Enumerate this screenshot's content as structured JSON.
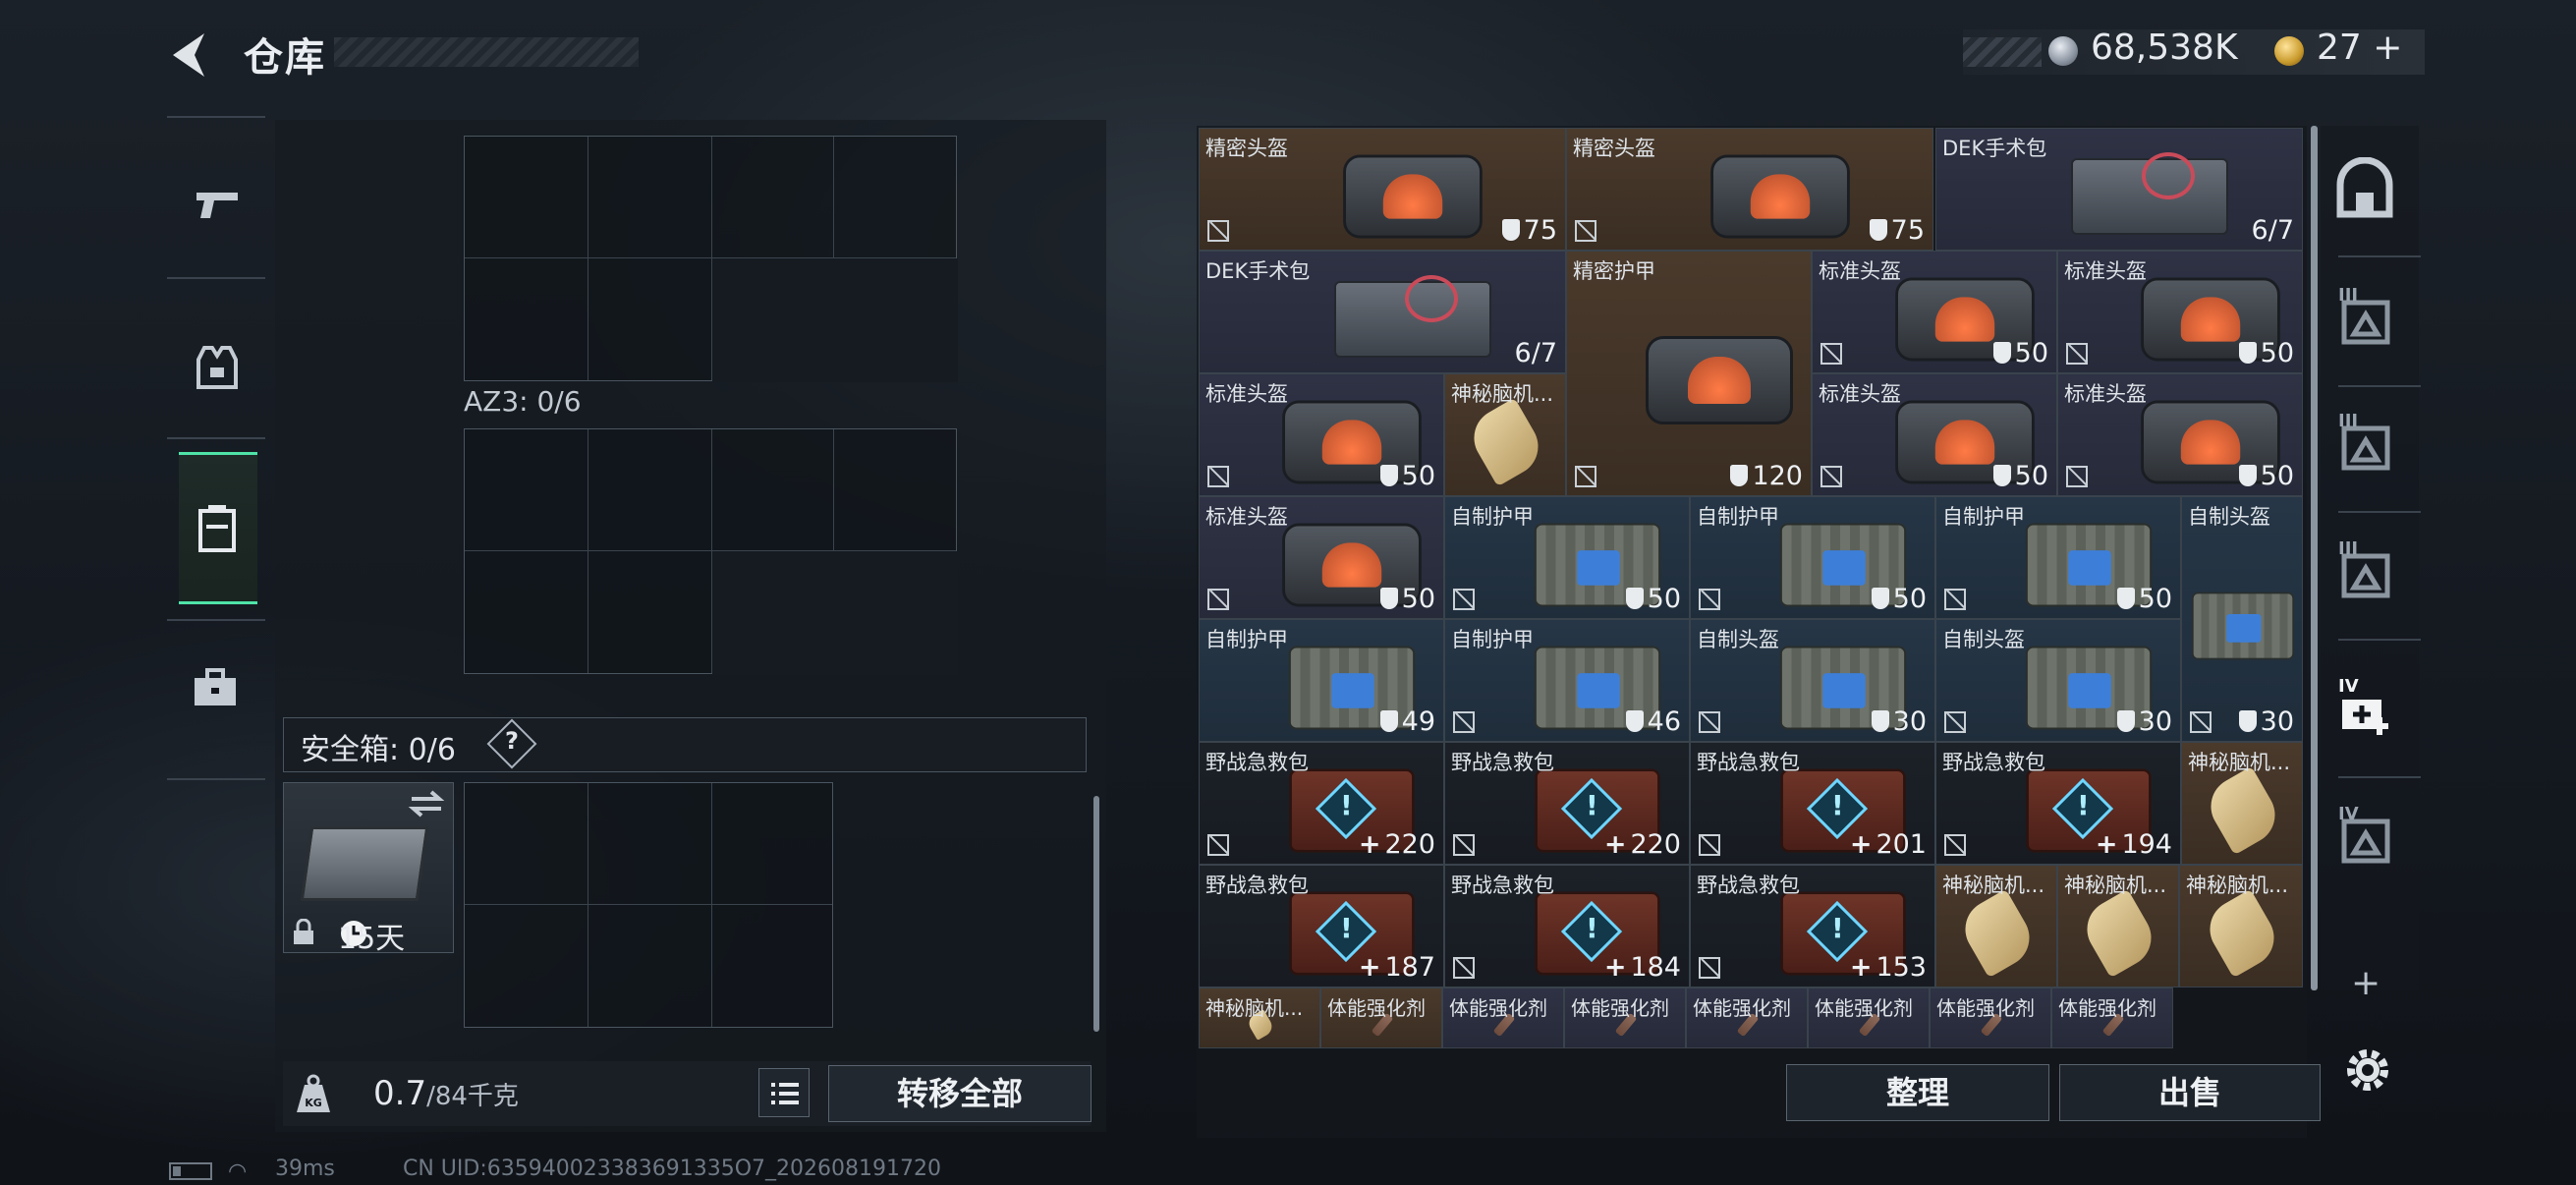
{
  "header": {
    "title": "仓库",
    "back_icon": "back-arrow-icon"
  },
  "currency": {
    "silver": "68,538K",
    "gold": "27",
    "gold_add": "+"
  },
  "left_nav": {
    "items": [
      {
        "name": "weapons",
        "icon": "pistol-icon"
      },
      {
        "name": "gear",
        "icon": "vest-icon"
      },
      {
        "name": "backpack",
        "icon": "backpack-icon",
        "active": true
      },
      {
        "name": "toolbox",
        "icon": "briefcase-icon"
      }
    ]
  },
  "container": {
    "az3_label": "AZ3: 0/6"
  },
  "safe_box": {
    "label": "安全箱: 0/6",
    "help": "?",
    "days": "15天"
  },
  "weight": {
    "current": "0.7",
    "capacity": "/84千克",
    "transfer_label": "转移全部"
  },
  "items": [
    {
      "name": "精密头盔",
      "value": "75",
      "kind": "shield",
      "bg": "brown",
      "pic": "helmet",
      "nosell": true
    },
    {
      "name": "精密头盔",
      "value": "75",
      "kind": "shield",
      "bg": "brown",
      "pic": "helmet",
      "nosell": true
    },
    {
      "name": "DEK手术包",
      "value": "6/7",
      "kind": "plain",
      "bg": "purple",
      "pic": "medkit",
      "nosell": false
    },
    {
      "name": "DEK手术包",
      "value": "6/7",
      "kind": "plain",
      "bg": "purple",
      "pic": "medkit",
      "nosell": false
    },
    {
      "name": "精密护甲",
      "value": "120",
      "kind": "shield",
      "bg": "brown",
      "pic": "helmet",
      "nosell": true
    },
    {
      "name": "标准头盔",
      "value": "50",
      "kind": "shield",
      "bg": "purple",
      "pic": "helmet",
      "nosell": true
    },
    {
      "name": "标准头盔",
      "value": "50",
      "kind": "shield",
      "bg": "purple",
      "pic": "helmet",
      "nosell": true
    },
    {
      "name": "标准头盔",
      "value": "50",
      "kind": "shield",
      "bg": "purple",
      "pic": "helmet",
      "nosell": true
    },
    {
      "name": "神秘脑机...",
      "value": "",
      "kind": "none",
      "bg": "brown",
      "pic": "chip",
      "nosell": false
    },
    {
      "name": "标准头盔",
      "value": "50",
      "kind": "shield",
      "bg": "purple",
      "pic": "helmet",
      "nosell": true
    },
    {
      "name": "标准头盔",
      "value": "50",
      "kind": "shield",
      "bg": "purple",
      "pic": "helmet",
      "nosell": true
    },
    {
      "name": "标准头盔",
      "value": "50",
      "kind": "shield",
      "bg": "purple",
      "pic": "helmet",
      "nosell": true
    },
    {
      "name": "自制护甲",
      "value": "50",
      "kind": "shield",
      "bg": "blue",
      "pic": "armor",
      "nosell": true
    },
    {
      "name": "自制护甲",
      "value": "50",
      "kind": "shield",
      "bg": "blue",
      "pic": "armor",
      "nosell": true
    },
    {
      "name": "自制护甲",
      "value": "50",
      "kind": "shield",
      "bg": "blue",
      "pic": "armor",
      "nosell": true
    },
    {
      "name": "自制头盔",
      "value": "30",
      "kind": "shield",
      "bg": "blue",
      "pic": "armor",
      "nosell": true
    },
    {
      "name": "自制护甲",
      "value": "49",
      "kind": "shield",
      "bg": "blue",
      "pic": "armor",
      "nosell": false
    },
    {
      "name": "自制护甲",
      "value": "46",
      "kind": "shield",
      "bg": "blue",
      "pic": "armor",
      "nosell": true
    },
    {
      "name": "自制头盔",
      "value": "30",
      "kind": "shield",
      "bg": "blue",
      "pic": "armor",
      "nosell": true
    },
    {
      "name": "自制头盔",
      "value": "30",
      "kind": "shield",
      "bg": "blue",
      "pic": "armor",
      "nosell": true
    },
    {
      "name": "野战急救包",
      "value": "220",
      "kind": "plus",
      "bg": "dark",
      "pic": "firstaid",
      "nosell": true
    },
    {
      "name": "野战急救包",
      "value": "220",
      "kind": "plus",
      "bg": "dark",
      "pic": "firstaid",
      "nosell": true
    },
    {
      "name": "野战急救包",
      "value": "201",
      "kind": "plus",
      "bg": "dark",
      "pic": "firstaid",
      "nosell": true
    },
    {
      "name": "野战急救包",
      "value": "194",
      "kind": "plus",
      "bg": "dark",
      "pic": "firstaid",
      "nosell": true
    },
    {
      "name": "神秘脑机...",
      "value": "",
      "kind": "none",
      "bg": "brown",
      "pic": "chip",
      "nosell": false
    },
    {
      "name": "野战急救包",
      "value": "187",
      "kind": "plus",
      "bg": "dark",
      "pic": "firstaid",
      "nosell": false
    },
    {
      "name": "野战急救包",
      "value": "184",
      "kind": "plus",
      "bg": "dark",
      "pic": "firstaid",
      "nosell": true
    },
    {
      "name": "野战急救包",
      "value": "153",
      "kind": "plus",
      "bg": "dark",
      "pic": "firstaid",
      "nosell": true
    },
    {
      "name": "神秘脑机...",
      "value": "",
      "kind": "none",
      "bg": "brown",
      "pic": "chip",
      "nosell": false
    },
    {
      "name": "神秘脑机...",
      "value": "",
      "kind": "none",
      "bg": "brown",
      "pic": "chip",
      "nosell": false
    },
    {
      "name": "神秘脑机...",
      "value": "",
      "kind": "none",
      "bg": "brown",
      "pic": "chip",
      "nosell": false
    },
    {
      "name": "神秘脑机...",
      "value": "",
      "kind": "none",
      "bg": "brown",
      "pic": "chip",
      "nosell": false
    },
    {
      "name": "体能强化剂",
      "value": "",
      "kind": "none",
      "bg": "brown",
      "pic": "syringe",
      "nosell": false
    },
    {
      "name": "体能强化剂",
      "value": "",
      "kind": "none",
      "bg": "purple",
      "pic": "syringe",
      "nosell": false
    },
    {
      "name": "体能强化剂",
      "value": "",
      "kind": "none",
      "bg": "purple",
      "pic": "syringe",
      "nosell": false
    },
    {
      "name": "体能强化剂",
      "value": "",
      "kind": "none",
      "bg": "purple",
      "pic": "syringe",
      "nosell": false
    },
    {
      "name": "体能强化剂",
      "value": "",
      "kind": "none",
      "bg": "purple",
      "pic": "syringe",
      "nosell": false
    },
    {
      "name": "体能强化剂",
      "value": "",
      "kind": "none",
      "bg": "purple",
      "pic": "syringe",
      "nosell": false
    },
    {
      "name": "体能强化剂",
      "value": "",
      "kind": "none",
      "bg": "purple",
      "pic": "syringe",
      "nosell": false
    }
  ],
  "actions": {
    "sort_label": "整理",
    "sell_label": "出售"
  },
  "right_nav": {
    "items": [
      {
        "icon": "safehouse-icon",
        "tier": ""
      },
      {
        "icon": "tier3-vest-icon",
        "tier": "III"
      },
      {
        "icon": "tier3-gear-icon",
        "tier": "III"
      },
      {
        "icon": "tier3-pack-icon",
        "tier": "III"
      },
      {
        "icon": "tier4-medkit-icon",
        "tier": "IV"
      },
      {
        "icon": "tier4-case-icon",
        "tier": "IV"
      }
    ],
    "add_label": "+",
    "settings_icon": "gear-icon"
  },
  "status": {
    "ping": "39ms",
    "uid": "CN UID:635940023383691335O7_202608191720"
  },
  "colors": {
    "accent": "#4fe3a8",
    "item_brown": "#4a3a2c",
    "item_purple": "#2e3244",
    "item_blue": "#263646",
    "item_dark": "#1c2128"
  }
}
